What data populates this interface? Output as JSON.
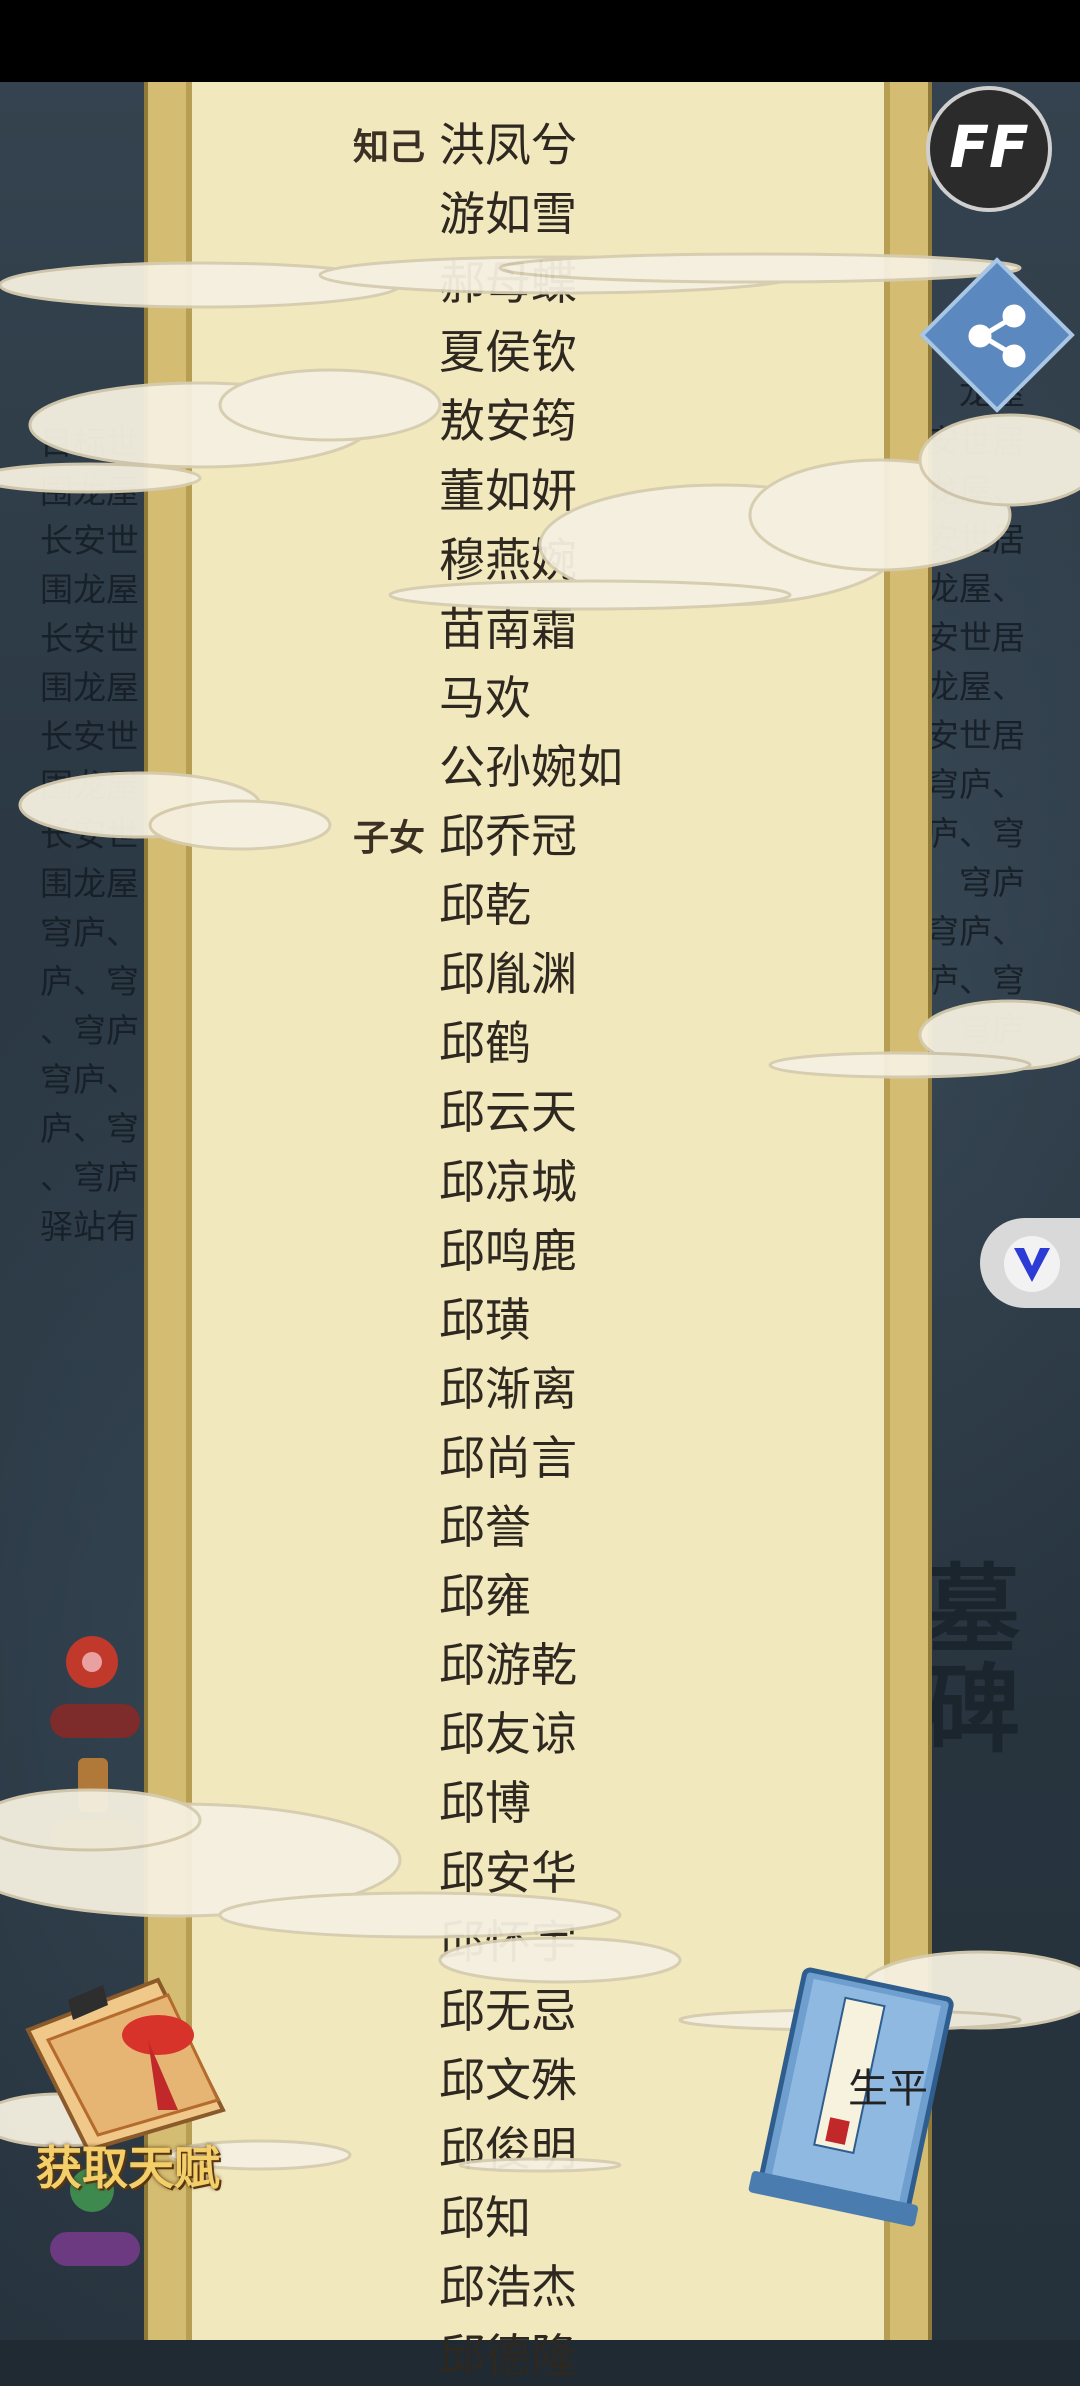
{
  "hud": {
    "ff_label": "FF",
    "talent_label": "获取天赋",
    "book_label": "生平",
    "tomb_label": "墓碑"
  },
  "background_text": {
    "left": "目标世\n围龙屋\n长安世\n围龙屋\n长安世\n围龙屋\n长安世\n围龙屋\n长安世\n围龙屋\n穹庐、\n庐、穹\n、穹庐\n穹庐、\n庐、穹\n、穹庐\n驿站有",
    "right": "龙屋\n安世居\n龙屋、\n安世居\n龙屋、\n安世居\n龙屋、\n安世居\n穹庐、\n庐、穹\n穹庐\n穹庐、\n庐、穹\n穹庐"
  },
  "scroll": {
    "rows": [
      {
        "category": "知己",
        "name": "洪凤兮"
      },
      {
        "category": "",
        "name": "游如雪"
      },
      {
        "category": "",
        "name": "郝母蝶"
      },
      {
        "category": "",
        "name": "夏侯钦"
      },
      {
        "category": "",
        "name": "敖安筠"
      },
      {
        "category": "",
        "name": "董如妍"
      },
      {
        "category": "",
        "name": "穆燕婉"
      },
      {
        "category": "",
        "name": "苗南霜"
      },
      {
        "category": "",
        "name": "马欢"
      },
      {
        "category": "",
        "name": "公孙婉如"
      },
      {
        "category": "子女",
        "name": "邱乔冠"
      },
      {
        "category": "",
        "name": "邱乾"
      },
      {
        "category": "",
        "name": "邱胤渊"
      },
      {
        "category": "",
        "name": "邱鹤"
      },
      {
        "category": "",
        "name": "邱云天"
      },
      {
        "category": "",
        "name": "邱凉城"
      },
      {
        "category": "",
        "name": "邱鸣鹿"
      },
      {
        "category": "",
        "name": "邱璜"
      },
      {
        "category": "",
        "name": "邱渐离"
      },
      {
        "category": "",
        "name": "邱尚言"
      },
      {
        "category": "",
        "name": "邱誉"
      },
      {
        "category": "",
        "name": "邱雍"
      },
      {
        "category": "",
        "name": "邱游乾"
      },
      {
        "category": "",
        "name": "邱友谅"
      },
      {
        "category": "",
        "name": "邱博"
      },
      {
        "category": "",
        "name": "邱安华"
      },
      {
        "category": "",
        "name": "邱怀宇"
      },
      {
        "category": "",
        "name": "邱无忌"
      },
      {
        "category": "",
        "name": "邱文殊"
      },
      {
        "category": "",
        "name": "邱俊明"
      },
      {
        "category": "",
        "name": "邱知"
      },
      {
        "category": "",
        "name": "邱浩杰"
      },
      {
        "category": "",
        "name": "邱德隆"
      }
    ]
  },
  "colors": {
    "paper": "#f2e8bd",
    "frame": "#d4bd72",
    "share": "#5b88be",
    "v_icon": "#2d3bd6",
    "talent_text": "#f3cf6a"
  },
  "icons": [
    "ff-icon",
    "share-icon",
    "v-icon",
    "scroll-icon",
    "book-icon"
  ]
}
